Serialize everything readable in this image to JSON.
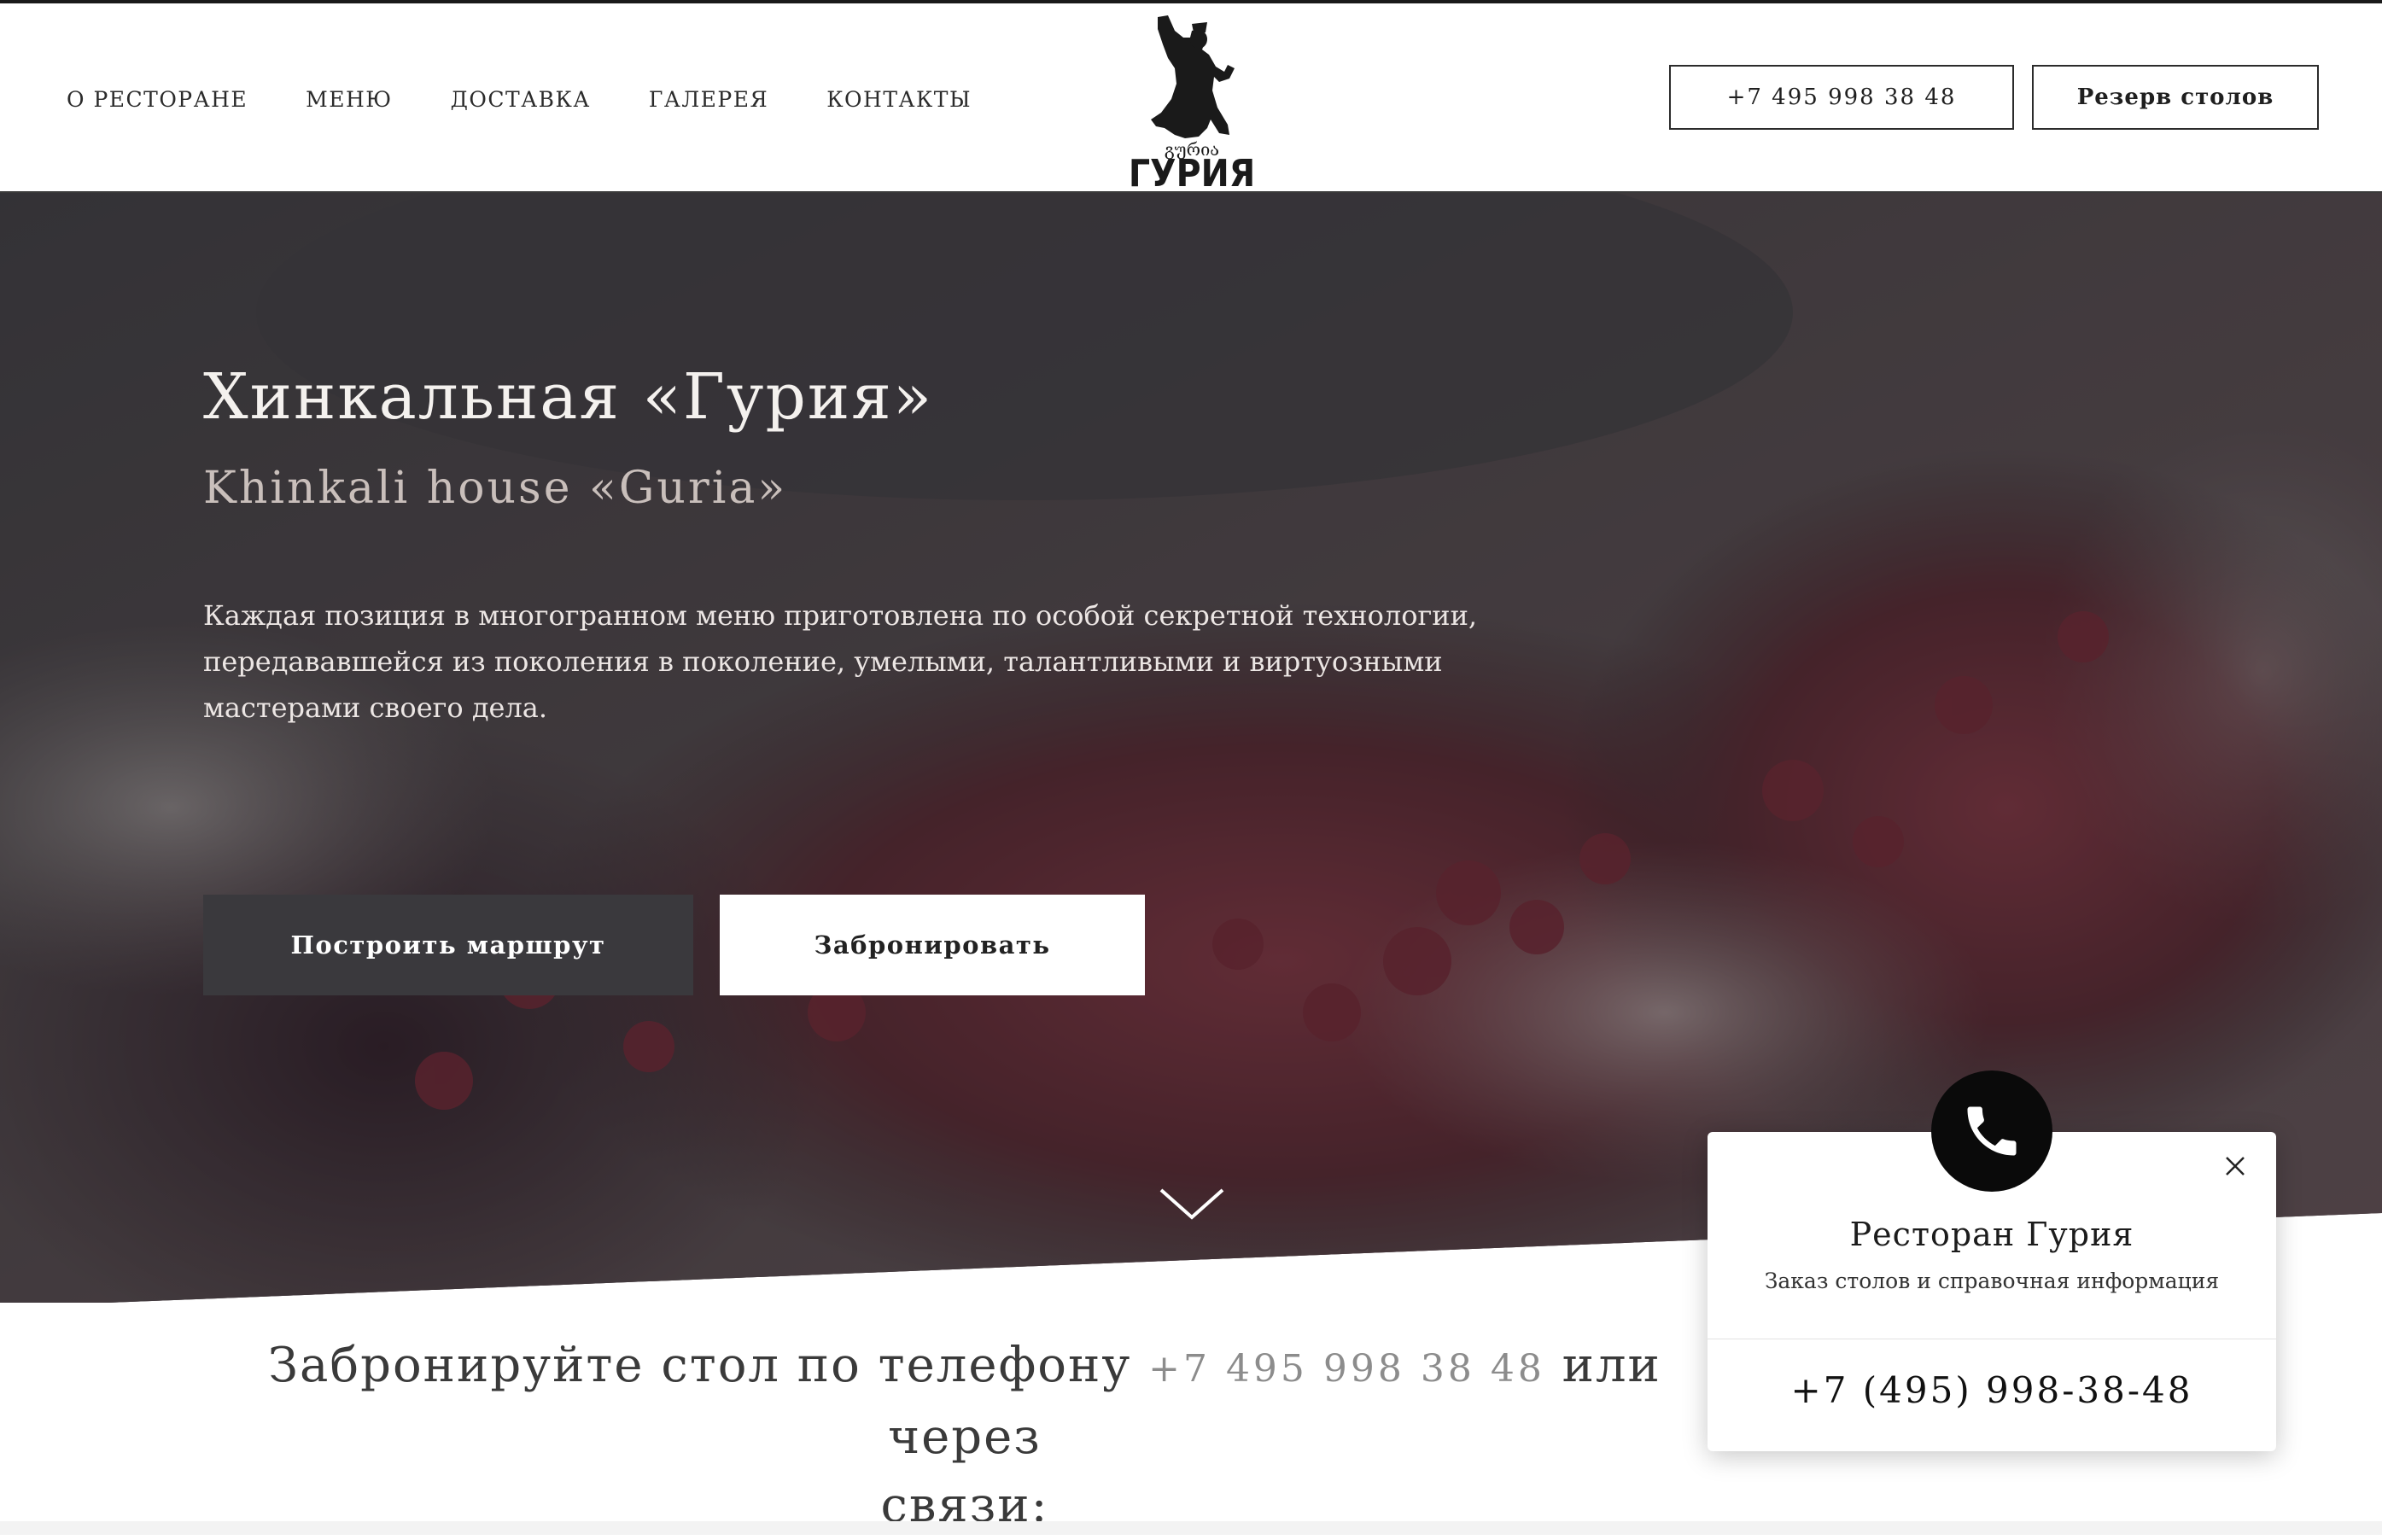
{
  "nav": {
    "items": [
      {
        "label": "О РЕСТОРАНЕ"
      },
      {
        "label": "МЕНЮ"
      },
      {
        "label": "ДОСТАВКА"
      },
      {
        "label": "ГАЛЕРЕЯ"
      },
      {
        "label": "КОНТАКТЫ"
      }
    ]
  },
  "logo": {
    "script_text": "გურია",
    "name": "ГУРИЯ"
  },
  "header": {
    "phone_label": "+7 495 998 38 48",
    "reserve_label": "Резерв столов"
  },
  "hero": {
    "title": "Хинкальная «Гурия»",
    "subtitle": "Khinkali house «Guria»",
    "text": "Каждая позиция в многогранном меню приготовлена по особой секретной технологии, передававшейся из поколения в поколение, умелыми, талантливыми и виртуозными мастерами своего дела.",
    "route_button": "Построить маршрут",
    "book_button": "Забронировать"
  },
  "booking": {
    "text_before": "Забронируйте стол по телефону ",
    "phone": "+7 495 998 38 48",
    "text_after": " или через",
    "line2": "связи:"
  },
  "widget": {
    "title": "Ресторан Гурия",
    "description": "Заказ столов и справочная информация",
    "phone": "+7 (495) 998-38-48"
  },
  "icons": {
    "phone": "phone-icon",
    "close": "close-icon",
    "scroll": "chevron-down-icon"
  }
}
